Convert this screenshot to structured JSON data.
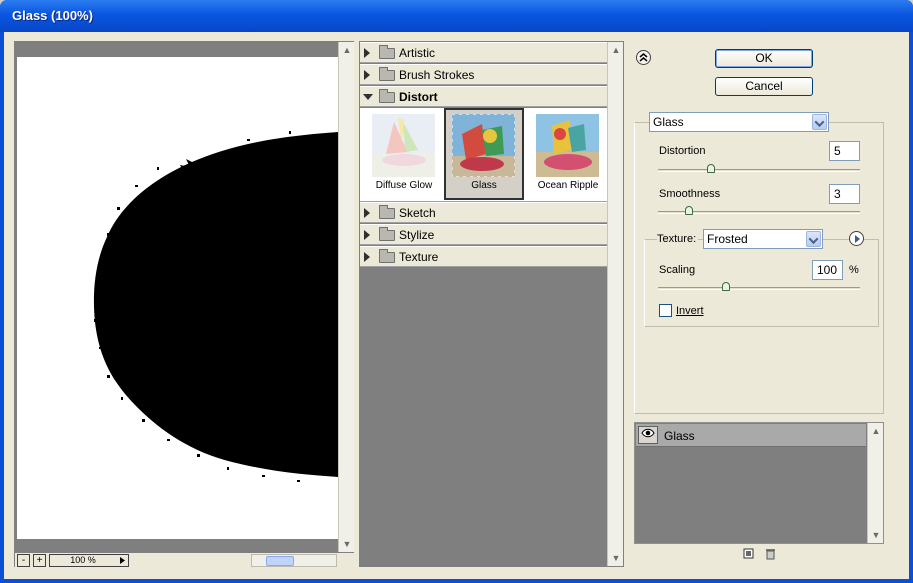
{
  "window": {
    "title": "Glass (100%)"
  },
  "preview": {
    "zoom_out": "-",
    "zoom_in": "+",
    "zoom_value": "100 %"
  },
  "browser": {
    "categories_top": [
      {
        "label": "Artistic",
        "expanded": false
      },
      {
        "label": "Brush Strokes",
        "expanded": false
      },
      {
        "label": "Distort",
        "expanded": true
      }
    ],
    "thumbnails": [
      {
        "label": "Diffuse Glow",
        "selected": false
      },
      {
        "label": "Glass",
        "selected": true
      },
      {
        "label": "Ocean Ripple",
        "selected": false
      }
    ],
    "categories_bottom": [
      {
        "label": "Sketch"
      },
      {
        "label": "Stylize"
      },
      {
        "label": "Texture"
      }
    ]
  },
  "buttons": {
    "ok": "OK",
    "cancel": "Cancel"
  },
  "settings": {
    "filter_select": "Glass",
    "distortion_label": "Distortion",
    "distortion_value": "5",
    "distortion_level": 0.25,
    "smoothness_label": "Smoothness",
    "smoothness_value": "3",
    "smoothness_level": 0.14,
    "texture_label": "Texture:",
    "texture_value": "Frosted",
    "scaling_label": "Scaling",
    "scaling_value": "100",
    "scaling_unit": "%",
    "scaling_level": 0.33,
    "invert_label": "Invert",
    "invert_checked": false
  },
  "layers": {
    "items": [
      {
        "name": "Glass",
        "visible": true
      }
    ]
  },
  "colors": {
    "title_bar": "#0a56e0",
    "panel": "#ece9d8",
    "grey": "#7f7f7f"
  }
}
